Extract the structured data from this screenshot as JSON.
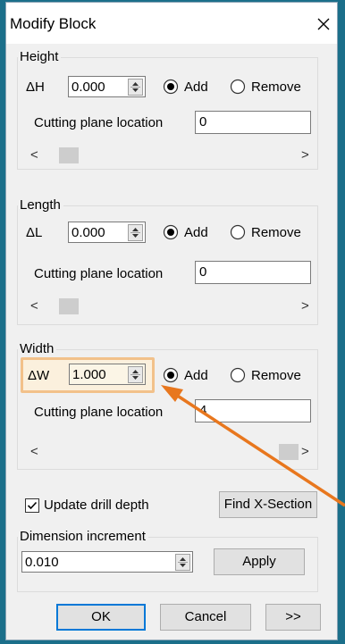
{
  "dialog": {
    "title": "Modify Block"
  },
  "height_group": {
    "label": "Height",
    "delta_label": "ΔH",
    "value": "0.000",
    "add_label": "Add",
    "remove_label": "Remove",
    "cut_label": "Cutting plane location",
    "cut_value": "0",
    "selected": "add"
  },
  "length_group": {
    "label": "Length",
    "delta_label": "ΔL",
    "value": "0.000",
    "add_label": "Add",
    "remove_label": "Remove",
    "cut_label": "Cutting plane location",
    "cut_value": "0",
    "selected": "add"
  },
  "width_group": {
    "label": "Width",
    "delta_label": "ΔW",
    "value": "1.000",
    "add_label": "Add",
    "remove_label": "Remove",
    "cut_label": "Cutting plane location",
    "cut_value": "4",
    "selected": "add",
    "highlight_color": "#f2c18a",
    "arrow_color": "#e8771e"
  },
  "options": {
    "update_drill_depth_label": "Update drill depth",
    "update_drill_depth_checked": true,
    "find_xsection_label": "Find X-Section"
  },
  "dimension_increment": {
    "label": "Dimension increment",
    "value": "0.010",
    "apply_label": "Apply"
  },
  "footer": {
    "ok_label": "OK",
    "cancel_label": "Cancel",
    "more_label": ">>"
  },
  "icons": {
    "close": "close-icon",
    "scroll_left": "chevron-left-icon",
    "scroll_right": "chevron-right-icon"
  }
}
